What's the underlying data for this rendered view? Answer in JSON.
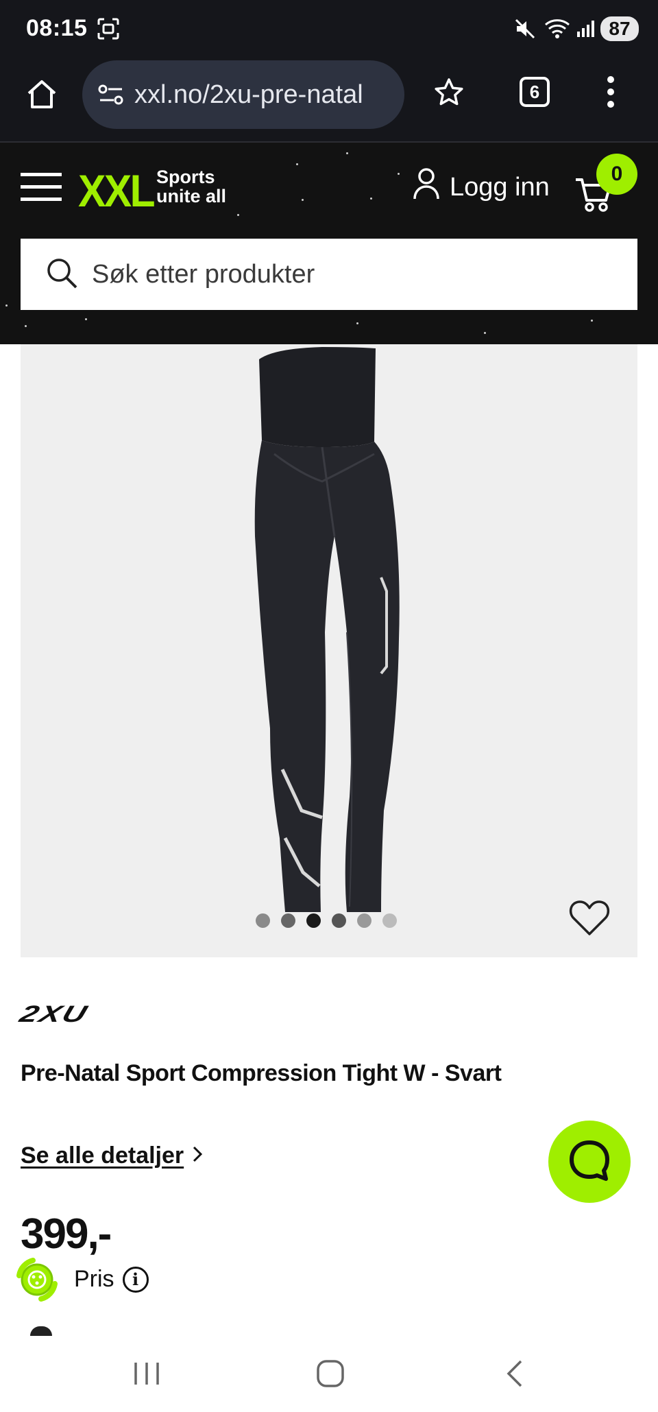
{
  "status_bar": {
    "time": "08:15",
    "battery": "87",
    "icons": [
      "screenshot-icon",
      "mute-icon",
      "wifi-icon",
      "signal-icon"
    ]
  },
  "browser": {
    "url": "xxl.no/2xu-pre-natal",
    "tab_count": "6",
    "icons": [
      "home-icon",
      "site-settings-icon",
      "bookmark-star-icon",
      "more-icon"
    ]
  },
  "site_header": {
    "logo_text": "XXL",
    "logo_tagline_line1": "Sports",
    "logo_tagline_line2": "unite all",
    "login_label": "Logg inn",
    "cart_count": "0",
    "search_placeholder": "Søk etter produkter"
  },
  "product": {
    "brand": "2XU",
    "title": "Pre-Natal Sport Compression Tight W - Svart",
    "details_link": "Se alle detaljer",
    "price": "399,-",
    "price_label": "Pris",
    "image_dots": {
      "count": 6,
      "active_index": 2
    }
  },
  "colors": {
    "accent": "#9fee00",
    "header_bg": "#121212",
    "status_bg": "#15161b",
    "image_bg": "#efefef"
  }
}
